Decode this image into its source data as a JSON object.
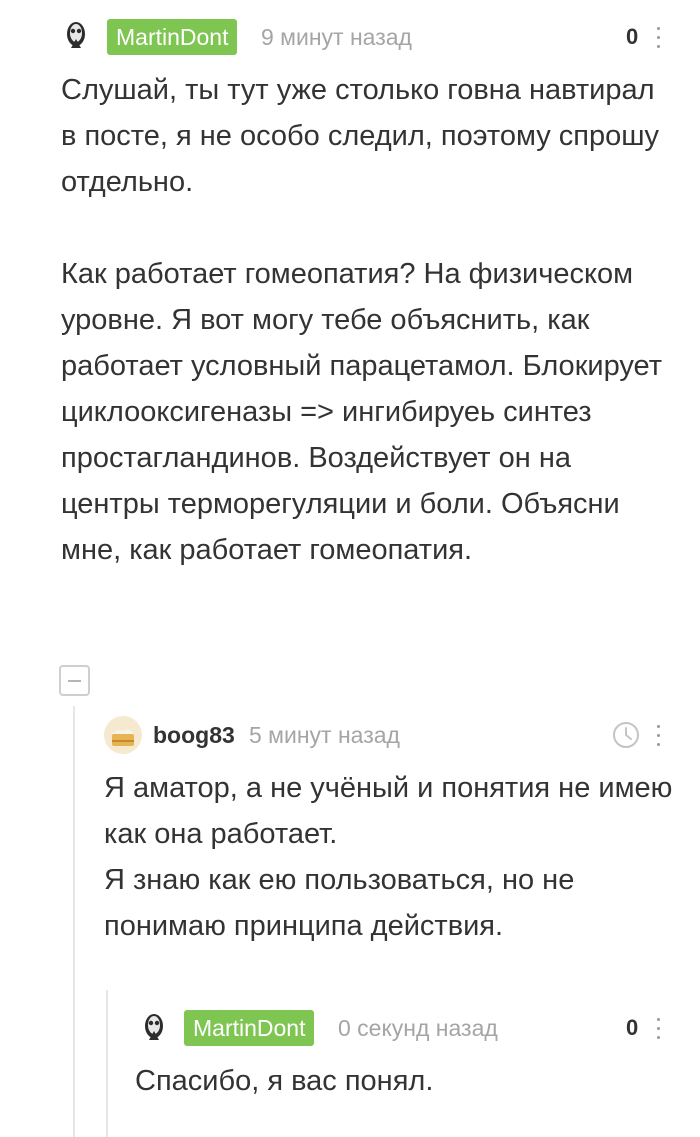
{
  "comments": [
    {
      "author": "MartinDont",
      "time": "9 минут назад",
      "rating": "0",
      "text": "Слушай, ты тут уже столько говна навтирал в посте, я не особо следил, поэтому спрошу отдельно.\n\nКак работает гомеопатия? На физическом уровне. Я вот могу тебе объяснить, как работает условный парацетамол. Блокирует циклооксигеназы => ингибируеь синтез простагландинов. Воздействует он на центры терморегуляции и боли. Объясни мне, как работает гомеопатия."
    },
    {
      "author": "boog83",
      "time": "5 минут назад",
      "text": "Я аматор, а не учёный и понятия не имею как она работает.\nЯ знаю как ею пользоваться, но не понимаю принципа действия."
    },
    {
      "author": "MartinDont",
      "time": "0 секунд назад",
      "rating": "0",
      "text": "Спасибо, я вас понял."
    }
  ],
  "icons": {
    "collapse": "minus-square-icon",
    "more": "more-vertical-icon",
    "clock": "clock-icon",
    "avatar_martin": "skull-avatar",
    "avatar_boog": "cake-avatar"
  },
  "colors": {
    "op_badge": "#7ec552",
    "muted": "#a5a5a5",
    "text": "#333333"
  }
}
